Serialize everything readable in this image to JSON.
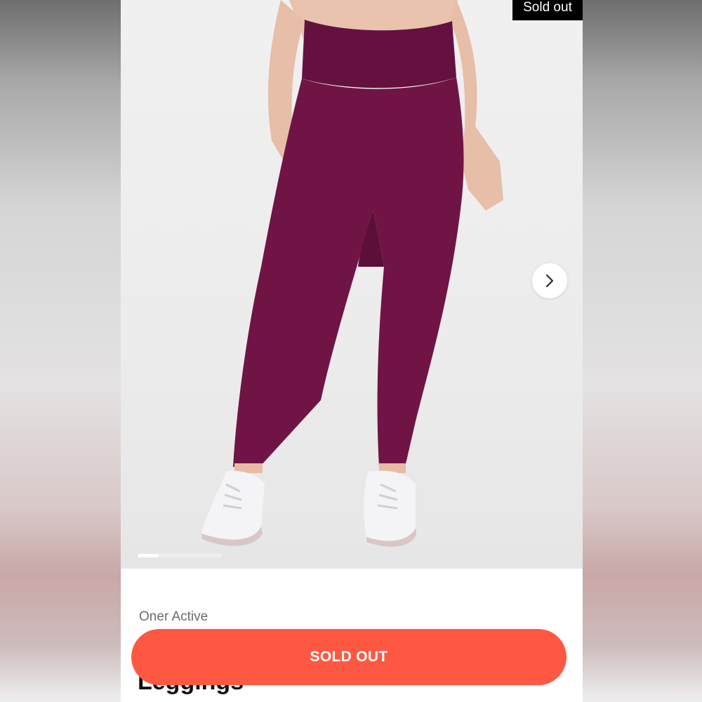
{
  "gallery": {
    "badge_label": "Sold out",
    "next_icon": "chevron-right-icon",
    "slide_progress": 0.25,
    "colors": {
      "leggings": "#6f1445",
      "background": "#ececec"
    }
  },
  "product": {
    "brand": "Oner Active",
    "title_partial": "Leggings"
  },
  "actions": {
    "sold_out_label": "SOLD OUT",
    "button_color": "#ff5842"
  }
}
